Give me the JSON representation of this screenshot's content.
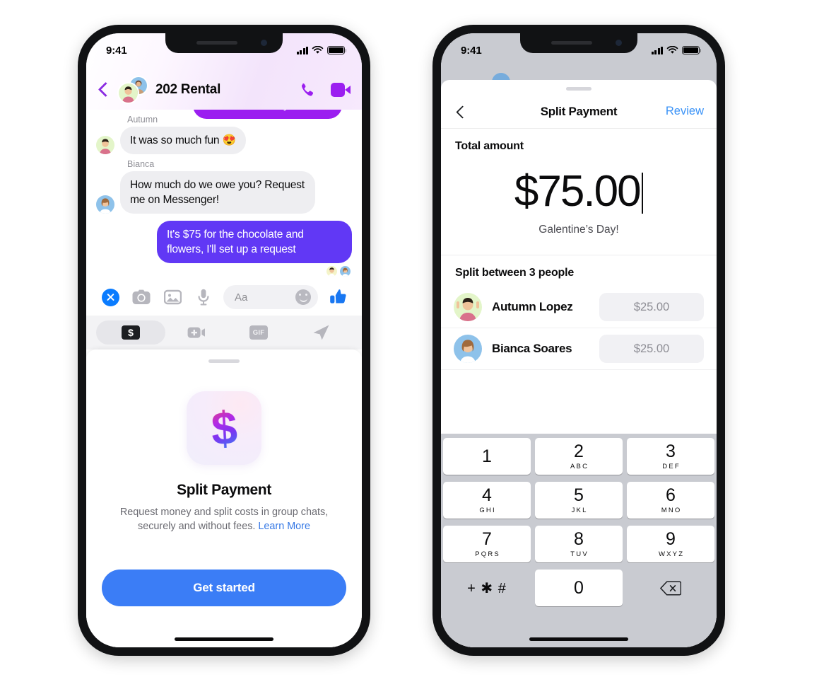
{
  "status_bar": {
    "time": "9:41"
  },
  "left_phone": {
    "header": {
      "title": "202 Rental",
      "back_icon": "chevron-left-icon",
      "call_icon": "phone-icon",
      "video_icon": "video-camera-icon"
    },
    "messages": [
      {
        "id": "m0",
        "direction": "out",
        "sender": "",
        "text": "Galentine's with you all ❤️",
        "style": "magenta"
      },
      {
        "id": "m1",
        "direction": "in",
        "sender": "Autumn",
        "text": "It was so much fun 😍"
      },
      {
        "id": "m2",
        "direction": "in",
        "sender": "Bianca",
        "text": "How much do we owe you? Request me on Messenger!"
      },
      {
        "id": "m3",
        "direction": "out",
        "sender": "",
        "text": "It's $75 for the chocolate and flowers, I'll set up a request"
      }
    ],
    "composer": {
      "close_icon": "close-circle-icon",
      "camera_icon": "camera-icon",
      "gallery_icon": "photo-icon",
      "mic_icon": "microphone-icon",
      "input_placeholder": "Aa",
      "emoji_icon": "smiley-icon",
      "like_icon": "thumbs-up-icon"
    },
    "tray": [
      {
        "id": "pay",
        "icon": "dollar-payment-icon",
        "label": "$",
        "active": true
      },
      {
        "id": "video",
        "icon": "add-video-icon",
        "active": false
      },
      {
        "id": "gif",
        "icon": "gif-icon",
        "label": "GIF",
        "active": false
      },
      {
        "id": "location",
        "icon": "send-location-icon",
        "active": false
      }
    ],
    "sheet": {
      "app_icon": "split-payment-dollar-icon",
      "title": "Split Payment",
      "description": "Request money and split costs in group chats, securely and without fees.",
      "learn_more": "Learn More",
      "cta_label": "Get started"
    }
  },
  "right_phone": {
    "nav": {
      "back_icon": "chevron-left-icon",
      "title": "Split Payment",
      "review_label": "Review"
    },
    "total_label": "Total amount",
    "amount": "$75.00",
    "memo": "Galentine’s Day!",
    "split_label": "Split between 3 people",
    "people": [
      {
        "name": "Autumn Lopez",
        "amount": "$25.00"
      },
      {
        "name": "Bianca Soares",
        "amount": "$25.00"
      }
    ],
    "keypad": [
      {
        "num": "1",
        "letters": ""
      },
      {
        "num": "2",
        "letters": "ABC"
      },
      {
        "num": "3",
        "letters": "DEF"
      },
      {
        "num": "4",
        "letters": "GHI"
      },
      {
        "num": "5",
        "letters": "JKL"
      },
      {
        "num": "6",
        "letters": "MNO"
      },
      {
        "num": "7",
        "letters": "PQRS"
      },
      {
        "num": "8",
        "letters": "TUV"
      },
      {
        "num": "9",
        "letters": "WXYZ"
      }
    ],
    "keypad_symbols": "+ ✱ #",
    "keypad_zero": "0",
    "keypad_delete_icon": "backspace-icon"
  },
  "colors": {
    "messenger_purple": "#6138f5",
    "magenta_bubble": "#9b1ef0",
    "cta_blue": "#3b7df6",
    "link_blue": "#3578e5",
    "review_blue": "#3b93f7",
    "incoming_grey": "#eeeef1",
    "keypad_bg": "#c9cbd1"
  }
}
